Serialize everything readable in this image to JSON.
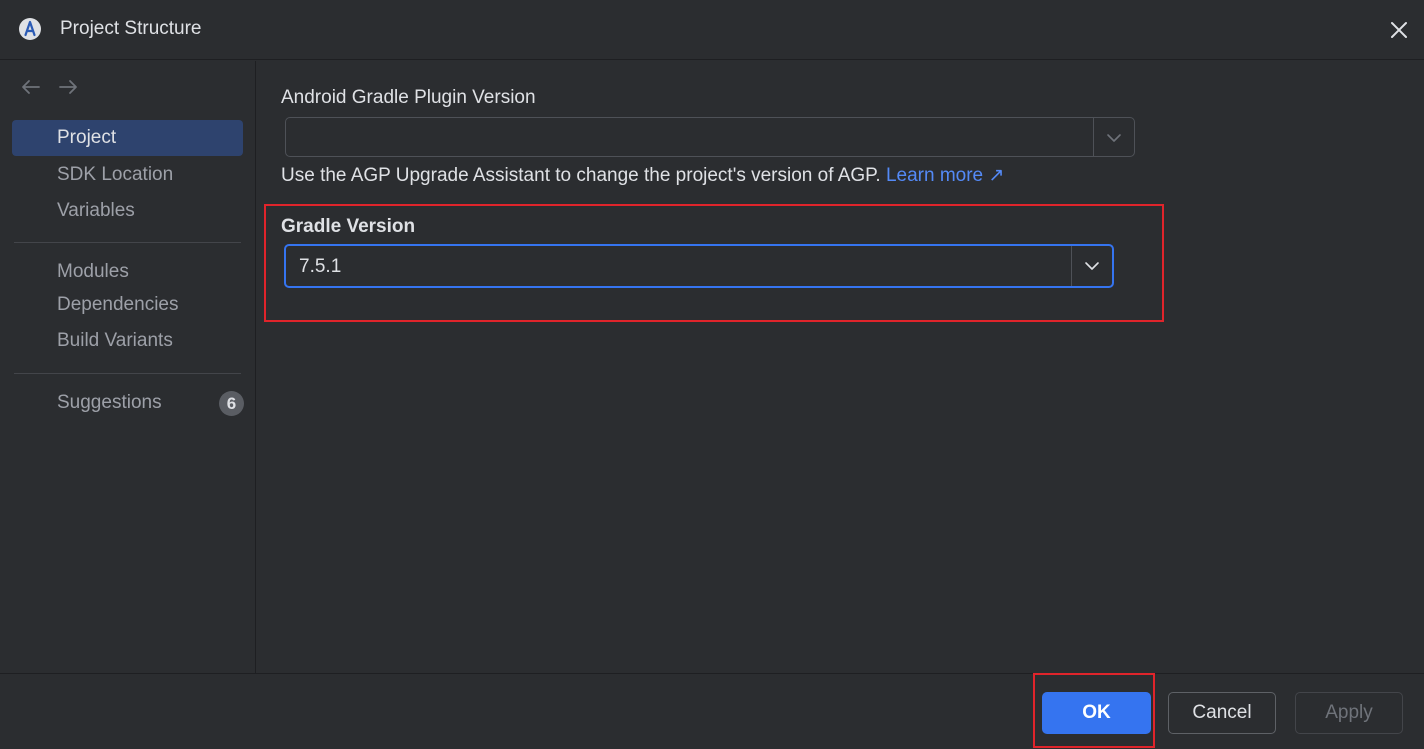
{
  "window": {
    "title": "Project Structure",
    "icon": "android-studio-icon"
  },
  "sidebar": {
    "items": [
      {
        "label": "Project",
        "selected": true
      },
      {
        "label": "SDK Location"
      },
      {
        "label": "Variables"
      },
      {
        "label": "Modules"
      },
      {
        "label": "Dependencies"
      },
      {
        "label": "Build Variants"
      },
      {
        "label": "Suggestions",
        "badge": "6"
      }
    ]
  },
  "main": {
    "agp": {
      "label": "Android Gradle Plugin Version",
      "value": "",
      "hint": "Use the AGP Upgrade Assistant to change the project's version of AGP.",
      "link": "Learn more ↗"
    },
    "gradle": {
      "label": "Gradle Version",
      "value": "7.5.1"
    }
  },
  "buttons": {
    "ok": "OK",
    "cancel": "Cancel",
    "apply": "Apply"
  },
  "colors": {
    "background": "#2b2d30",
    "accent": "#3574f0",
    "selection": "#2e436e",
    "link": "#548af7",
    "highlight": "#e0242b"
  }
}
